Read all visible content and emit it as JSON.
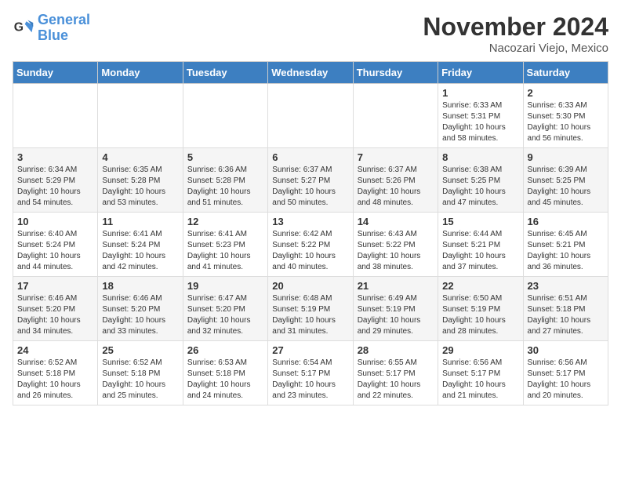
{
  "header": {
    "logo_line1": "General",
    "logo_line2": "Blue",
    "month": "November 2024",
    "location": "Nacozari Viejo, Mexico"
  },
  "weekdays": [
    "Sunday",
    "Monday",
    "Tuesday",
    "Wednesday",
    "Thursday",
    "Friday",
    "Saturday"
  ],
  "weeks": [
    [
      {
        "day": "",
        "info": ""
      },
      {
        "day": "",
        "info": ""
      },
      {
        "day": "",
        "info": ""
      },
      {
        "day": "",
        "info": ""
      },
      {
        "day": "",
        "info": ""
      },
      {
        "day": "1",
        "info": "Sunrise: 6:33 AM\nSunset: 5:31 PM\nDaylight: 10 hours\nand 58 minutes."
      },
      {
        "day": "2",
        "info": "Sunrise: 6:33 AM\nSunset: 5:30 PM\nDaylight: 10 hours\nand 56 minutes."
      }
    ],
    [
      {
        "day": "3",
        "info": "Sunrise: 6:34 AM\nSunset: 5:29 PM\nDaylight: 10 hours\nand 54 minutes."
      },
      {
        "day": "4",
        "info": "Sunrise: 6:35 AM\nSunset: 5:28 PM\nDaylight: 10 hours\nand 53 minutes."
      },
      {
        "day": "5",
        "info": "Sunrise: 6:36 AM\nSunset: 5:28 PM\nDaylight: 10 hours\nand 51 minutes."
      },
      {
        "day": "6",
        "info": "Sunrise: 6:37 AM\nSunset: 5:27 PM\nDaylight: 10 hours\nand 50 minutes."
      },
      {
        "day": "7",
        "info": "Sunrise: 6:37 AM\nSunset: 5:26 PM\nDaylight: 10 hours\nand 48 minutes."
      },
      {
        "day": "8",
        "info": "Sunrise: 6:38 AM\nSunset: 5:25 PM\nDaylight: 10 hours\nand 47 minutes."
      },
      {
        "day": "9",
        "info": "Sunrise: 6:39 AM\nSunset: 5:25 PM\nDaylight: 10 hours\nand 45 minutes."
      }
    ],
    [
      {
        "day": "10",
        "info": "Sunrise: 6:40 AM\nSunset: 5:24 PM\nDaylight: 10 hours\nand 44 minutes."
      },
      {
        "day": "11",
        "info": "Sunrise: 6:41 AM\nSunset: 5:24 PM\nDaylight: 10 hours\nand 42 minutes."
      },
      {
        "day": "12",
        "info": "Sunrise: 6:41 AM\nSunset: 5:23 PM\nDaylight: 10 hours\nand 41 minutes."
      },
      {
        "day": "13",
        "info": "Sunrise: 6:42 AM\nSunset: 5:22 PM\nDaylight: 10 hours\nand 40 minutes."
      },
      {
        "day": "14",
        "info": "Sunrise: 6:43 AM\nSunset: 5:22 PM\nDaylight: 10 hours\nand 38 minutes."
      },
      {
        "day": "15",
        "info": "Sunrise: 6:44 AM\nSunset: 5:21 PM\nDaylight: 10 hours\nand 37 minutes."
      },
      {
        "day": "16",
        "info": "Sunrise: 6:45 AM\nSunset: 5:21 PM\nDaylight: 10 hours\nand 36 minutes."
      }
    ],
    [
      {
        "day": "17",
        "info": "Sunrise: 6:46 AM\nSunset: 5:20 PM\nDaylight: 10 hours\nand 34 minutes."
      },
      {
        "day": "18",
        "info": "Sunrise: 6:46 AM\nSunset: 5:20 PM\nDaylight: 10 hours\nand 33 minutes."
      },
      {
        "day": "19",
        "info": "Sunrise: 6:47 AM\nSunset: 5:20 PM\nDaylight: 10 hours\nand 32 minutes."
      },
      {
        "day": "20",
        "info": "Sunrise: 6:48 AM\nSunset: 5:19 PM\nDaylight: 10 hours\nand 31 minutes."
      },
      {
        "day": "21",
        "info": "Sunrise: 6:49 AM\nSunset: 5:19 PM\nDaylight: 10 hours\nand 29 minutes."
      },
      {
        "day": "22",
        "info": "Sunrise: 6:50 AM\nSunset: 5:19 PM\nDaylight: 10 hours\nand 28 minutes."
      },
      {
        "day": "23",
        "info": "Sunrise: 6:51 AM\nSunset: 5:18 PM\nDaylight: 10 hours\nand 27 minutes."
      }
    ],
    [
      {
        "day": "24",
        "info": "Sunrise: 6:52 AM\nSunset: 5:18 PM\nDaylight: 10 hours\nand 26 minutes."
      },
      {
        "day": "25",
        "info": "Sunrise: 6:52 AM\nSunset: 5:18 PM\nDaylight: 10 hours\nand 25 minutes."
      },
      {
        "day": "26",
        "info": "Sunrise: 6:53 AM\nSunset: 5:18 PM\nDaylight: 10 hours\nand 24 minutes."
      },
      {
        "day": "27",
        "info": "Sunrise: 6:54 AM\nSunset: 5:17 PM\nDaylight: 10 hours\nand 23 minutes."
      },
      {
        "day": "28",
        "info": "Sunrise: 6:55 AM\nSunset: 5:17 PM\nDaylight: 10 hours\nand 22 minutes."
      },
      {
        "day": "29",
        "info": "Sunrise: 6:56 AM\nSunset: 5:17 PM\nDaylight: 10 hours\nand 21 minutes."
      },
      {
        "day": "30",
        "info": "Sunrise: 6:56 AM\nSunset: 5:17 PM\nDaylight: 10 hours\nand 20 minutes."
      }
    ]
  ]
}
